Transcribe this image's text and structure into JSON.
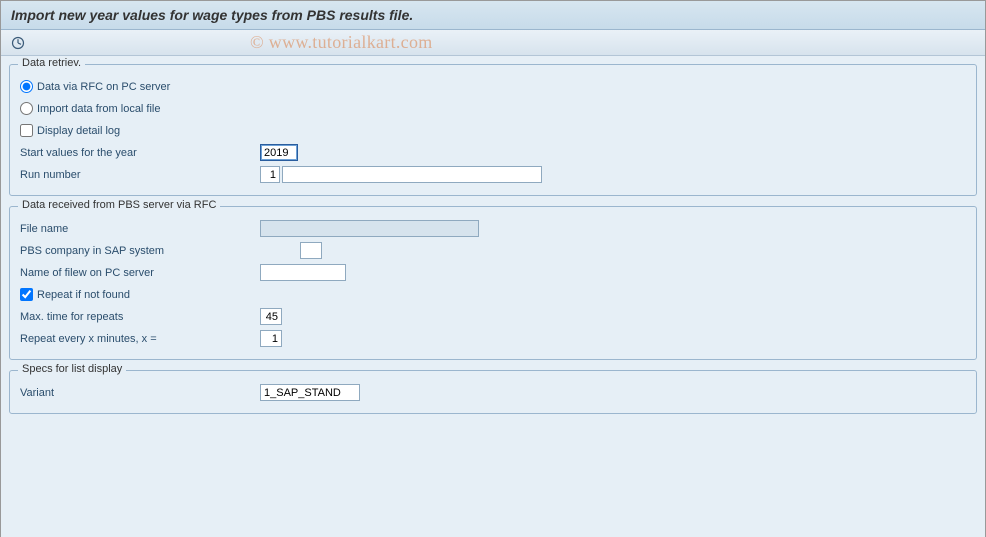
{
  "title": "Import new year values for wage types from PBS results file.",
  "watermark": "© www.tutorialkart.com",
  "group1": {
    "title": "Data retriev.",
    "radio1": "Data via RFC on PC server",
    "radio2": "Import data from local file",
    "check1": "Display detail log",
    "year_label": "Start values for the year",
    "year_value": "2019",
    "run_label": "Run number",
    "run_value": "1",
    "run_extra": ""
  },
  "group2": {
    "title": "Data received from PBS server via RFC",
    "file_label": "File name",
    "file_value": "",
    "company_label": "PBS company in SAP system",
    "company_value": "",
    "pcfile_label": "Name of filew on PC server",
    "pcfile_value": "",
    "repeat_label": "Repeat if not found",
    "maxtime_label": "Max. time for repeats",
    "maxtime_value": "45",
    "every_label": "Repeat every x minutes, x =",
    "every_value": "1"
  },
  "group3": {
    "title": "Specs for list display",
    "variant_label": "Variant",
    "variant_value": "1_SAP_STAND"
  }
}
